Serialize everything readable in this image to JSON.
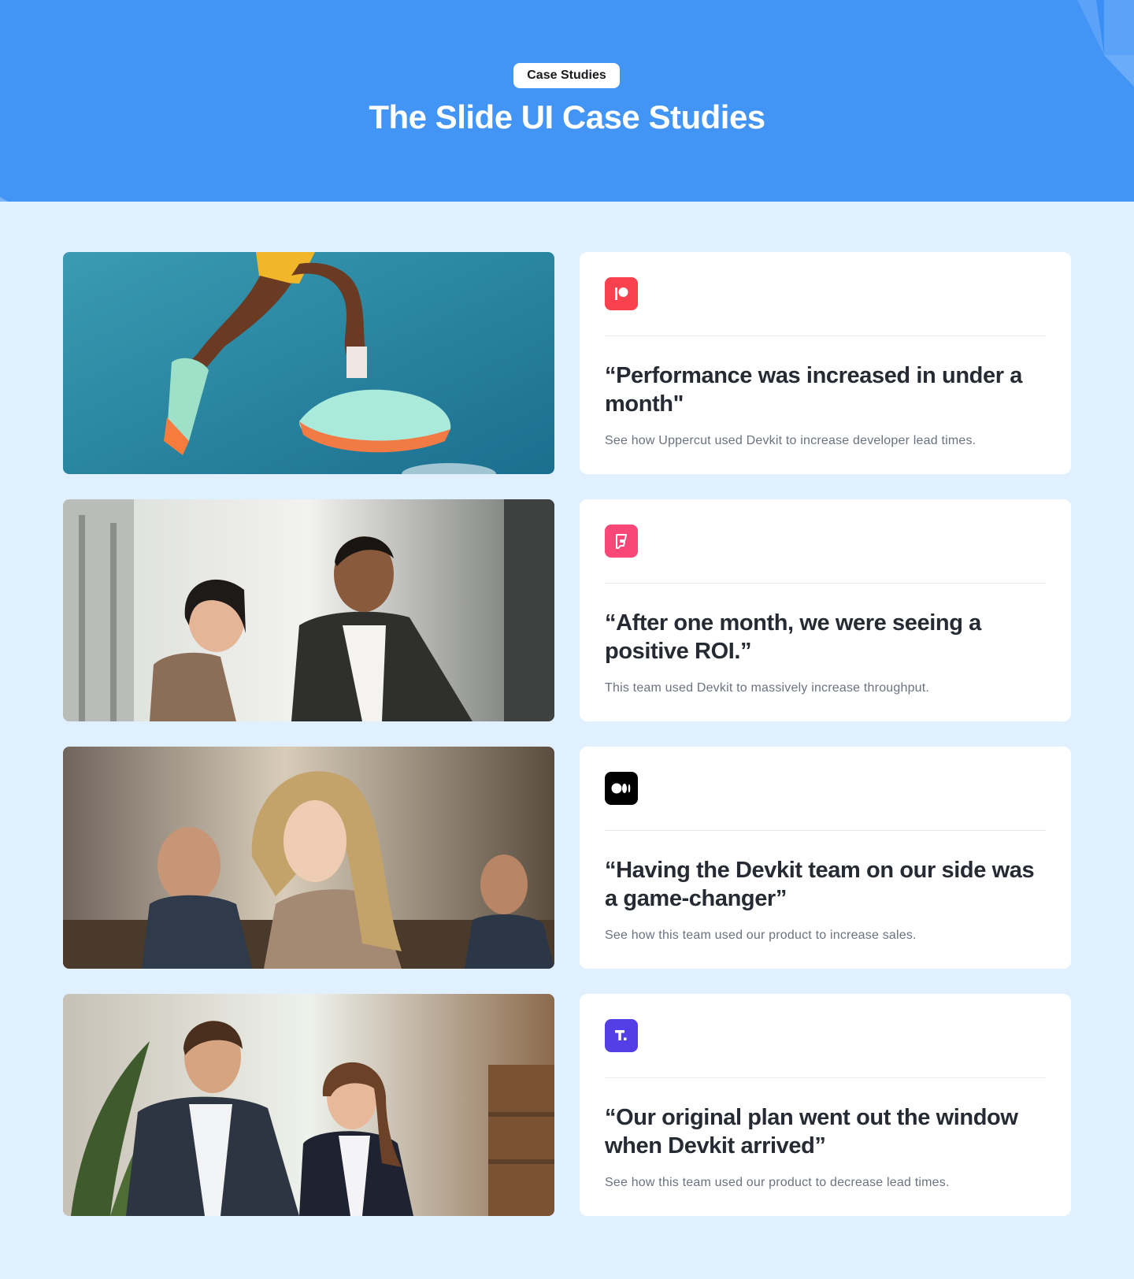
{
  "hero": {
    "badge": "Case Studies",
    "title": "The Slide UI Case Studies"
  },
  "colors": {
    "hero_bg": "#4294f5",
    "page_bg": "#e1f0fe",
    "card_bg": "#ffffff",
    "quote_text": "#262b33",
    "desc_text": "#6b7280"
  },
  "case_studies": [
    {
      "image": "runner-legs-sneakers-photo",
      "logo_icon": "patreon-logo-icon",
      "logo_color": "#f9424e",
      "quote": "“Performance was increased in under a month\"",
      "description": "See how Uppercut used Devkit to increase developer lead times."
    },
    {
      "image": "two-colleagues-office-photo",
      "logo_icon": "foursquare-logo-icon",
      "logo_color": "#f94877",
      "quote": "“After one month, we were seeing a positive ROI.”",
      "description": "This team used Devkit to massively increase throughput."
    },
    {
      "image": "student-classroom-photo",
      "logo_icon": "medium-logo-icon",
      "logo_color": "#000000",
      "quote": "“Having the Devkit team on our side was a game-changer”",
      "description": "See how this team used our product to increase sales."
    },
    {
      "image": "business-couple-office-photo",
      "logo_icon": "typeform-logo-icon",
      "logo_color": "#5240e6",
      "quote": "“Our original plan went out the window when Devkit arrived”",
      "description": "See how this team used our product to decrease lead times."
    }
  ]
}
